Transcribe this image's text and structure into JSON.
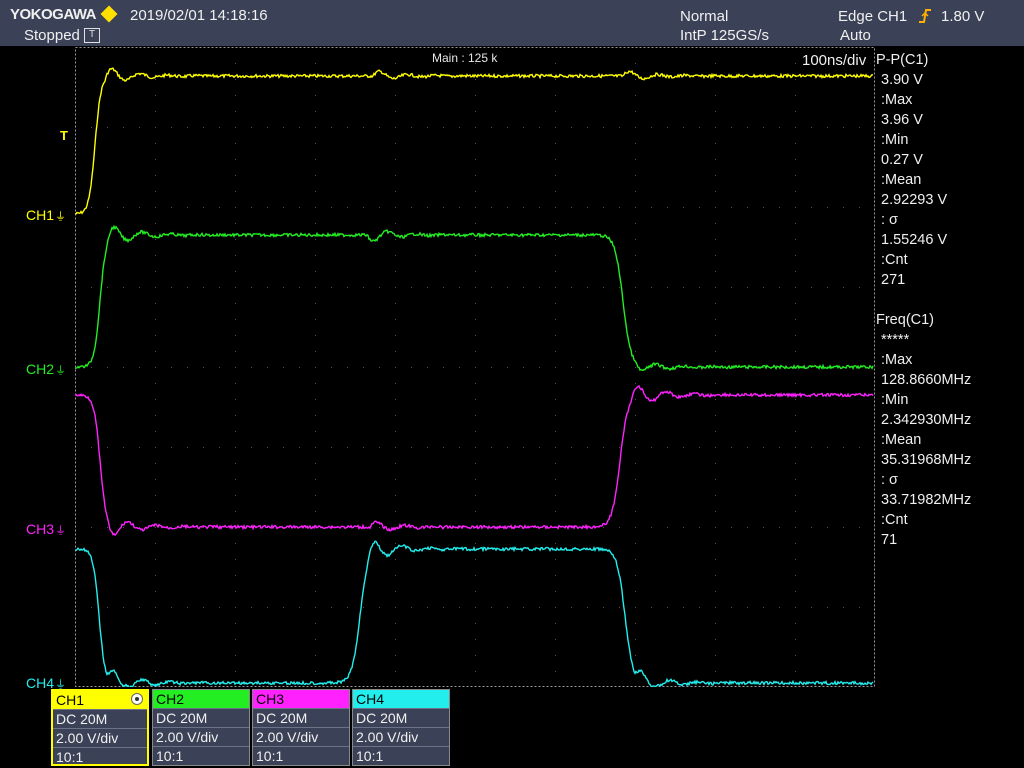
{
  "header": {
    "brand": "YOKOGAWA",
    "datetime": "2019/02/01 14:18:16",
    "run_state": "Stopped",
    "acq_mode": "Normal",
    "acq_rate": "IntP  125GS/s",
    "trigger_type": "Edge CH1",
    "trigger_level": "1.80 V",
    "trigger_mode": "Auto",
    "brand_color": "#ffe000"
  },
  "display": {
    "main_label": "Main : 125 k",
    "timebase": "100ns/div",
    "trigger_marker": "T"
  },
  "channels": [
    {
      "label": "CH1",
      "color": "#ffff00",
      "coupling": "DC 20M",
      "scale": "2.00 V/div",
      "probe": "10:1"
    },
    {
      "label": "CH2",
      "color": "#22ee22",
      "coupling": "DC 20M",
      "scale": "2.00 V/div",
      "probe": "10:1"
    },
    {
      "label": "CH3",
      "color": "#ff22ff",
      "coupling": "DC 20M",
      "scale": "2.00 V/div",
      "probe": "10:1"
    },
    {
      "label": "CH4",
      "color": "#22eeee",
      "coupling": "DC 20M",
      "scale": "2.00 V/div",
      "probe": "10:1"
    }
  ],
  "measurements": {
    "pp": {
      "title": "P-P(C1)",
      "value": "3.90 V",
      "max_label": ":Max",
      "max": "3.96 V",
      "min_label": ":Min",
      "min": "0.27 V",
      "mean_label": ":Mean",
      "mean": "2.92293 V",
      "sigma_label": ": σ",
      "sigma": "1.55246 V",
      "cnt_label": ":Cnt",
      "cnt": "271"
    },
    "freq": {
      "title": "Freq(C1)",
      "value": "*****",
      "max_label": ":Max",
      "max": "128.8660MHz",
      "min_label": ":Min",
      "min": "2.342930MHz",
      "mean_label": ":Mean",
      "mean": "35.31968MHz",
      "sigma_label": ": σ",
      "sigma": "33.71982MHz",
      "cnt_label": ":Cnt",
      "cnt": "71"
    }
  }
}
